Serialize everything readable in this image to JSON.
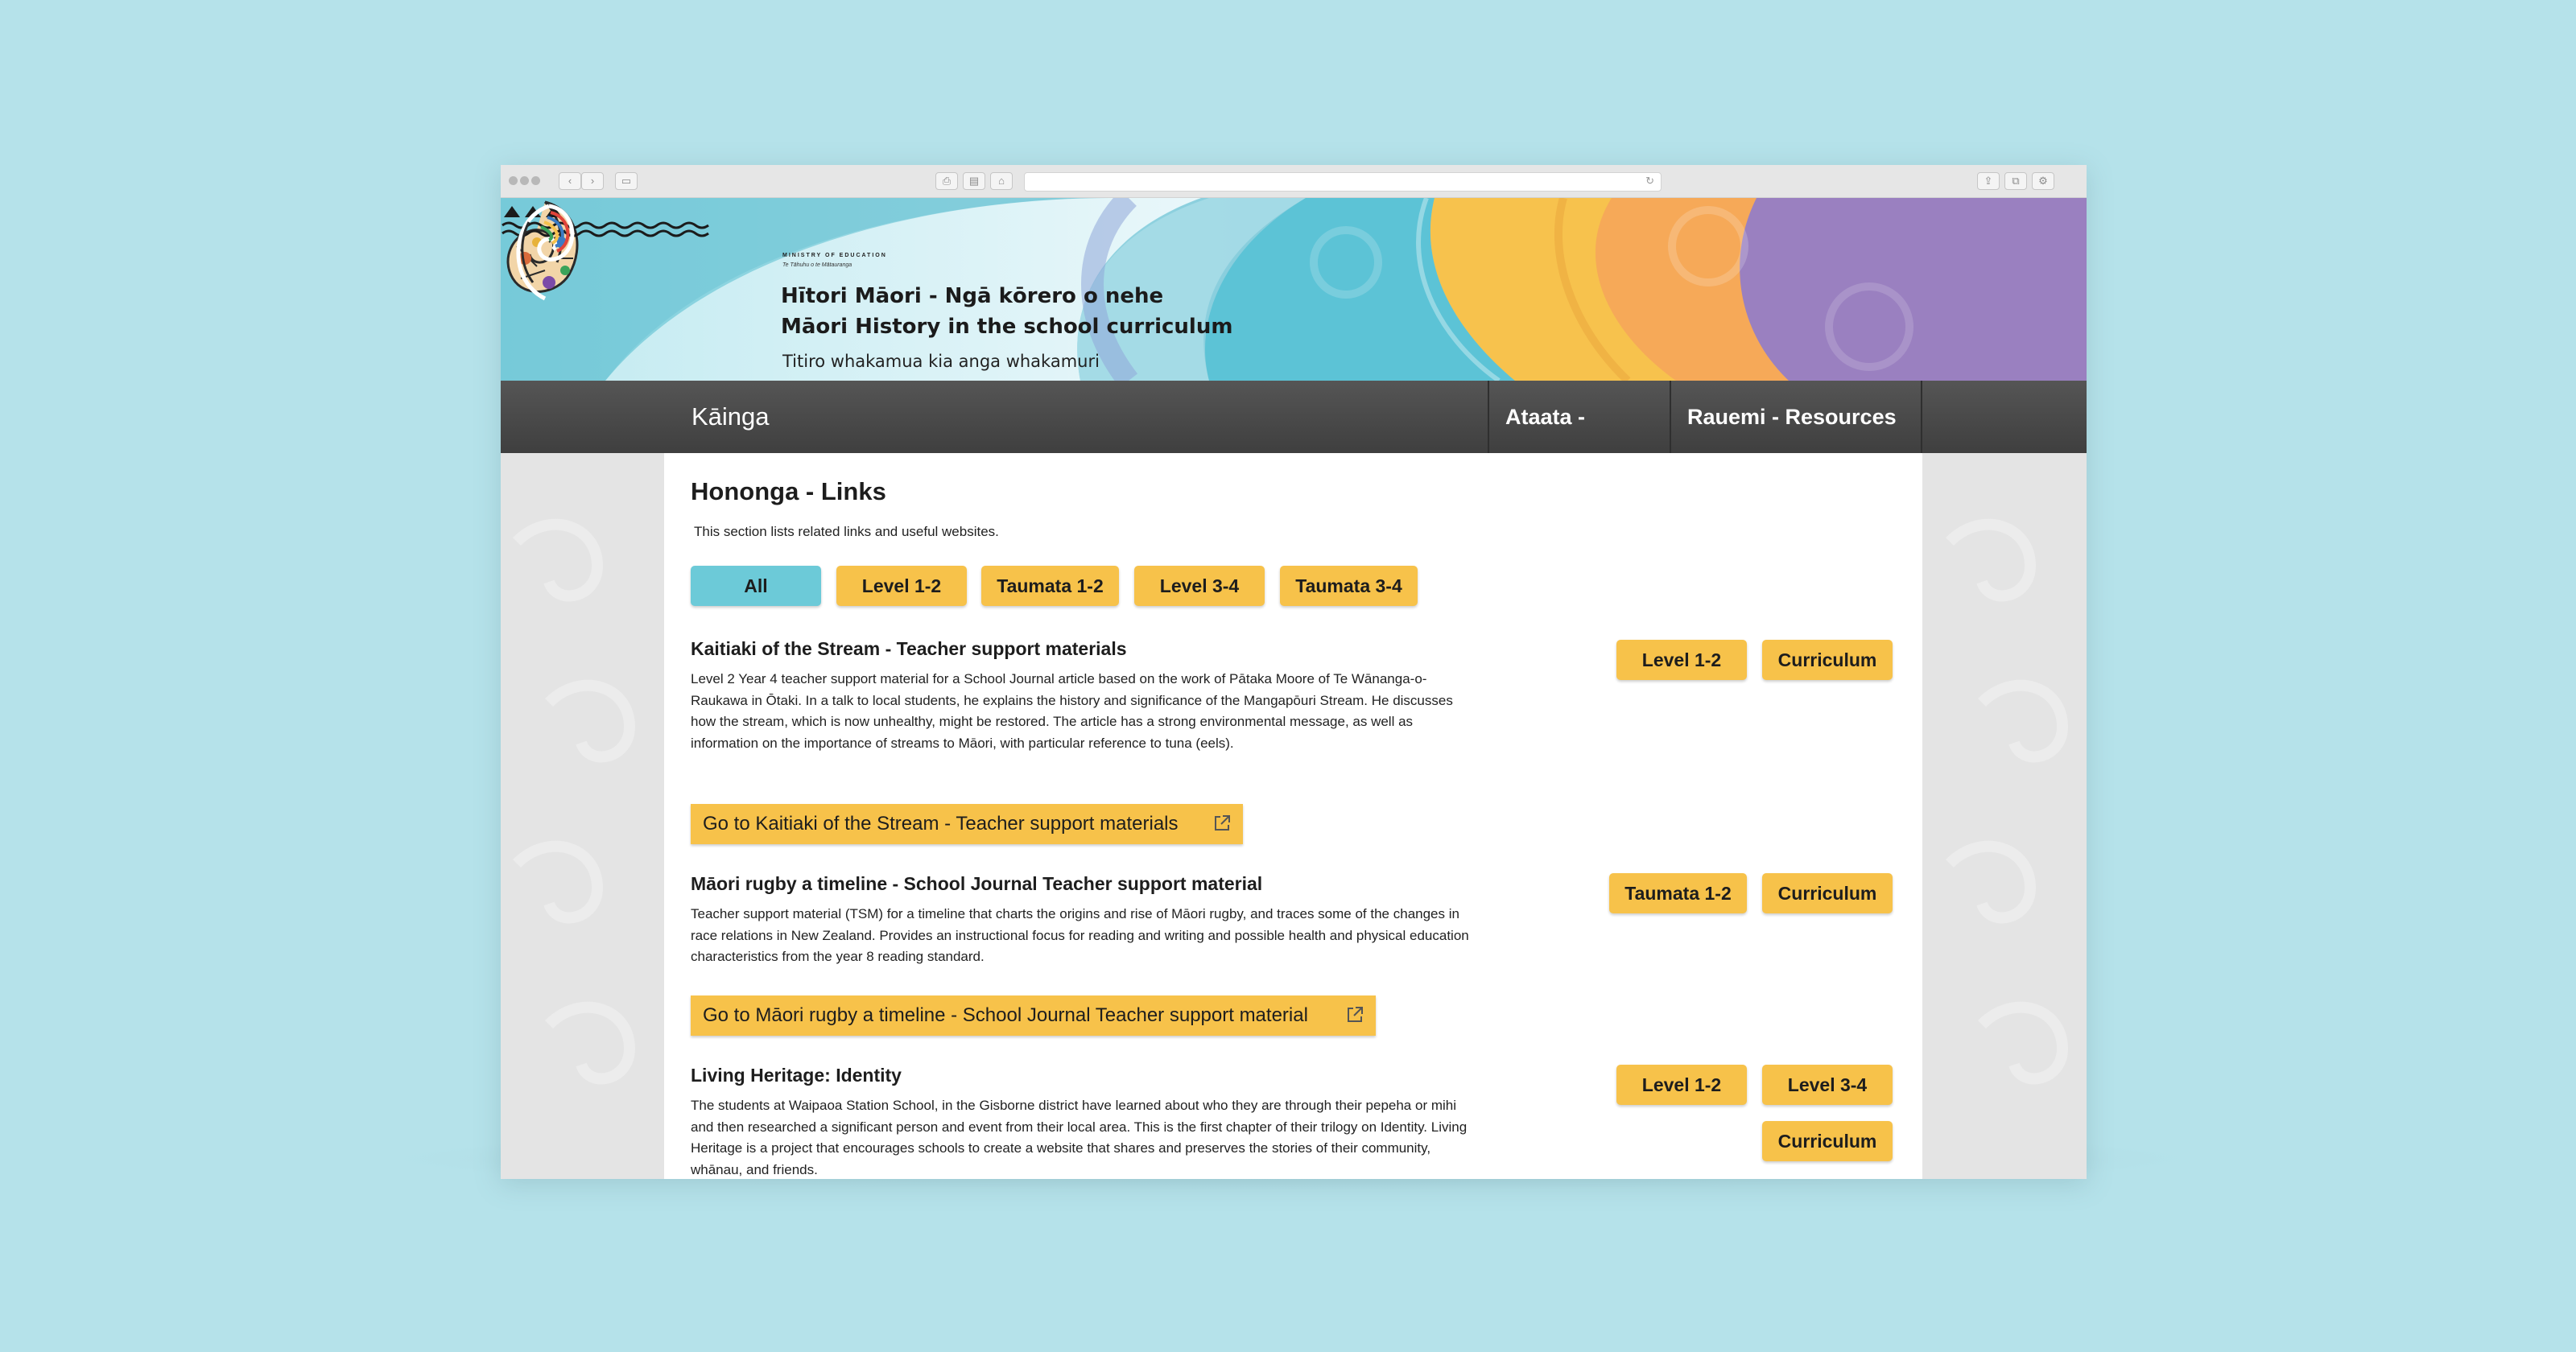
{
  "browser": {
    "nav_back": "‹",
    "nav_forward": "›"
  },
  "banner": {
    "ministry": "MINISTRY OF EDUCATION",
    "ministry_sub": "Te Tāhuhu o te Mātauranga",
    "title_line1": "Hītori Māori - Ngā kōrero o nehe",
    "title_line2": "Māori History in the school curriculum",
    "tagline": "Titiro whakamua kia anga whakamuri"
  },
  "nav": {
    "home": "Kāinga",
    "videos": "Ataata - Videos",
    "resources": "Rauemi - Resources"
  },
  "page": {
    "title": "Hononga - Links",
    "intro": "This section lists related links and useful websites."
  },
  "filters": [
    "All",
    "Level 1-2",
    "Taumata 1-2",
    "Level 3-4",
    "Taumata 3-4"
  ],
  "entries": [
    {
      "title": "Kaitiaki of the Stream - Teacher support materials",
      "description": "Level 2 Year 4 teacher support material for a School Journal article based on the work of Pātaka Moore of Te Wānanga-o-Raukawa in Ōtaki. In a talk to local students, he explains the history and significance of the Mangapōuri Stream. He discusses how the stream, which is now unhealthy, might be restored. The article has a strong environmental message, as well as information on the importance of streams to Māori, with particular reference to tuna (eels).",
      "link": "Go to Kaitiaki of the Stream - Teacher support materials",
      "tags": [
        "Level 1-2",
        "Curriculum"
      ]
    },
    {
      "title": "Māori rugby a timeline - School Journal Teacher support material",
      "description": "Teacher support material (TSM) for a timeline that charts the origins and rise of Māori rugby, and traces some of the changes in race relations in New Zealand. Provides an instructional focus for reading and writing and possible health and physical education characteristics from the year 8 reading standard.",
      "link": "Go to Māori rugby a timeline - School Journal Teacher support material",
      "tags": [
        "Taumata 1-2",
        "Curriculum"
      ]
    },
    {
      "title": "Living Heritage: Identity",
      "description": "The students at Waipaoa Station School, in the Gisborne district have learned about who they are through their pepeha or mihi and then researched a significant person and event from their local area. This is the first chapter of their trilogy on Identity. Living Heritage is a project that encourages schools to create a website that shares and preserves the stories of their community, whānau, and friends.",
      "tags": [
        "Level 1-2",
        "Level 3-4",
        "Curriculum"
      ]
    }
  ],
  "icons": {
    "external_link": "external-link-icon",
    "dropdown": "caret-down-icon"
  },
  "colors": {
    "accent_yellow": "#f7c24a",
    "active_teal": "#6ccad8",
    "nav_bg": "#4a4a4a",
    "page_bg": "#b5e2ea"
  }
}
